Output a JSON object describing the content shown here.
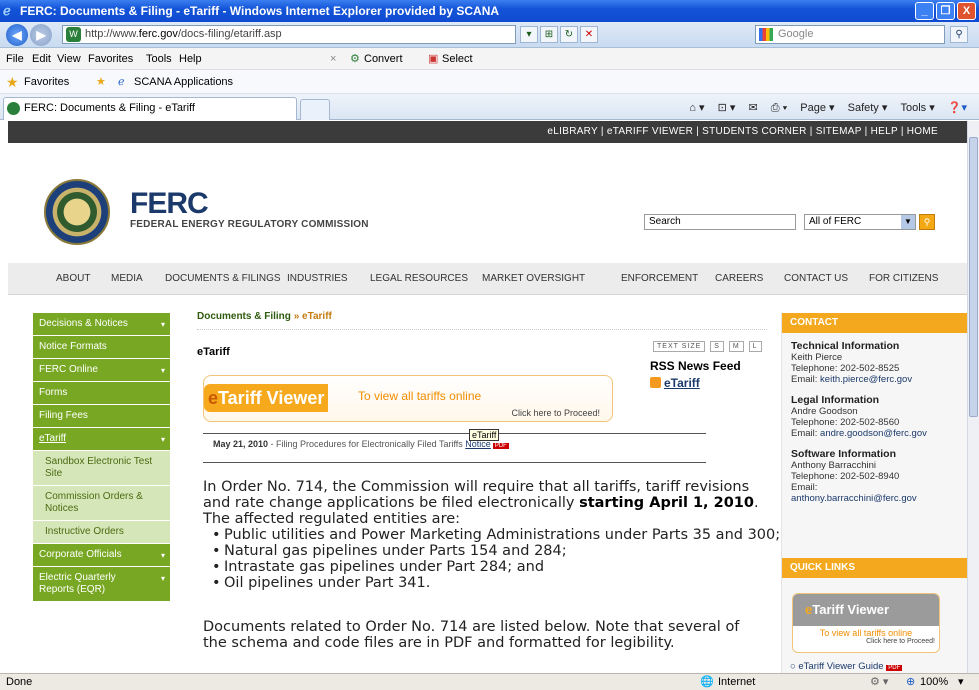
{
  "window": {
    "title": "FERC: Documents & Filing - eTariff - Windows Internet Explorer provided by SCANA",
    "minimize": "_",
    "maximize": "❐",
    "close": "X"
  },
  "address_bar": {
    "url_prefix": "http://www.",
    "url_domain": "ferc.gov",
    "url_path": "/docs-filing/etariff.asp",
    "search_placeholder": "Google"
  },
  "menu": {
    "items": [
      "File",
      "Edit",
      "View",
      "Favorites",
      "Tools",
      "Help"
    ],
    "convert": "Convert",
    "select": "Select"
  },
  "favorites_bar": {
    "favorites": "Favorites",
    "scana": "SCANA Applications"
  },
  "tab": {
    "title": "FERC: Documents & Filing - eTariff"
  },
  "command_bar": {
    "page": "Page ▾",
    "safety": "Safety ▾",
    "tools": "Tools ▾"
  },
  "site": {
    "top_links": "eLIBRARY | eTARIFF VIEWER | STUDENTS CORNER | SITEMAP | HELP | HOME",
    "logo_title": "FERC",
    "logo_sub": "FEDERAL ENERGY REGULATORY COMMISSION",
    "search_value": "Search",
    "scope_select": "All of FERC",
    "main_nav": [
      "ABOUT",
      "MEDIA",
      "DOCUMENTS & FILINGS",
      "INDUSTRIES",
      "LEGAL RESOURCES",
      "MARKET OVERSIGHT",
      "ENFORCEMENT",
      "CAREERS",
      "CONTACT US",
      "FOR CITIZENS"
    ]
  },
  "sidebar": {
    "items": [
      {
        "label": "Decisions & Notices",
        "type": "main",
        "caret": "▾"
      },
      {
        "label": "Notice Formats",
        "type": "main",
        "caret": ""
      },
      {
        "label": "FERC Online",
        "type": "main",
        "caret": "▾"
      },
      {
        "label": "Forms",
        "type": "main",
        "caret": ""
      },
      {
        "label": "Filing Fees",
        "type": "main",
        "caret": ""
      },
      {
        "label": "eTariff",
        "type": "main",
        "caret": "▾"
      },
      {
        "label": "Sandbox Electronic Test Site",
        "type": "sub",
        "caret": ""
      },
      {
        "label": "Commission Orders & Notices",
        "type": "sub",
        "caret": ""
      },
      {
        "label": "Instructive Orders",
        "type": "sub",
        "caret": ""
      },
      {
        "label": "Corporate Officials",
        "type": "main",
        "caret": "▾"
      },
      {
        "label": "Electric Quarterly Reports (EQR)",
        "type": "main",
        "caret": "▾"
      }
    ]
  },
  "content": {
    "breadcrumb_parent": "Documents & Filing",
    "breadcrumb_sep": "»",
    "breadcrumb_current": "eTariff",
    "title": "eTariff",
    "text_size_label": "TEXT SIZE",
    "text_size_s": "S",
    "text_size_m": "M",
    "text_size_l": "L",
    "rss_title": "RSS News Feed",
    "rss_link": "eTariff",
    "banner_e": "e",
    "banner_main": "Tariff Viewer",
    "banner_sub": "To view all tariffs online",
    "banner_click": "Click here to Proceed!",
    "news_date": "May 21, 2010",
    "news_text": " - Filing Procedures for Electronically Filed Tariffs ",
    "news_link": "Notice",
    "news_pdf": "PDF",
    "tooltip": "eTariff",
    "intro_a": "In Order No. 714, the Commission will require that all tariffs, tariff revisions and rate change applications be filed electronically ",
    "intro_b": "starting April 1, 2010",
    "intro_c": ". The affected regulated entities are:",
    "bullets": [
      "Public utilities and Power Marketing Administrations under Parts 35 and 300;",
      "Natural gas pipelines under Parts 154 and 284;",
      "Intrastate gas pipelines under Part 284; and",
      "Oil pipelines under Part 341."
    ],
    "docs_text": "Documents related to Order No. 714 are listed below. Note that several of the schema and code files are in PDF and formatted for legibility."
  },
  "right": {
    "contact_head": "CONTACT",
    "tech_title": "Technical Information",
    "tech_name": "Keith Pierce",
    "tech_phone": "Telephone: 202-502-8525",
    "tech_email_label": "Email: ",
    "tech_email": "keith.pierce@ferc.gov",
    "legal_title": "Legal Information",
    "legal_name": "Andre Goodson",
    "legal_phone": "Telephone: 202-502-8560",
    "legal_email_label": "Email: ",
    "legal_email": "andre.goodson@ferc.gov",
    "soft_title": "Software Information",
    "soft_name": "Anthony Barracchini",
    "soft_phone": "Telephone: 202-502-8940",
    "soft_email_label": "Email:",
    "soft_email": "anthony.barracchini@ferc.gov",
    "quick_head": "QUICK LINKS",
    "ql_e": "e",
    "ql_main": "Tariff Viewer",
    "ql_sub": "To view all tariffs online",
    "ql_click": "Click here to Proceed!",
    "guide": "eTariff Viewer Guide",
    "guide_pdf": "PDF"
  },
  "status": {
    "left": "Done",
    "zone": "Internet",
    "zoom": "100%"
  }
}
